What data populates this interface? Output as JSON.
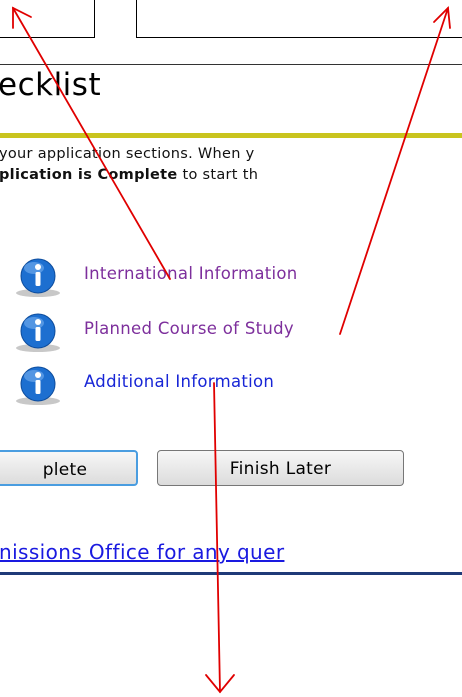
{
  "page": {
    "title": "ecklist",
    "description_line1": "your application sections. When y",
    "description_line2_bold1": "plication is Complete",
    "description_line2_rest": " to start th"
  },
  "checklist": {
    "items": [
      {
        "label": "International Information",
        "icon": "info-icon",
        "state": "visited"
      },
      {
        "label": "Planned Course of Study",
        "icon": "info-icon",
        "state": "visited"
      },
      {
        "label": "Additional Information",
        "icon": "info-icon",
        "state": "unvisited"
      }
    ]
  },
  "buttons": {
    "complete_label": "plete",
    "finish_later_label": "Finish Later"
  },
  "footer": {
    "contact_link": "nissions Office for any quer"
  },
  "colors": {
    "accent_bar": "#c9c41e",
    "annotation_arrow": "#e00000",
    "visited_link": "#7d2f9c",
    "link": "#1826d6"
  }
}
